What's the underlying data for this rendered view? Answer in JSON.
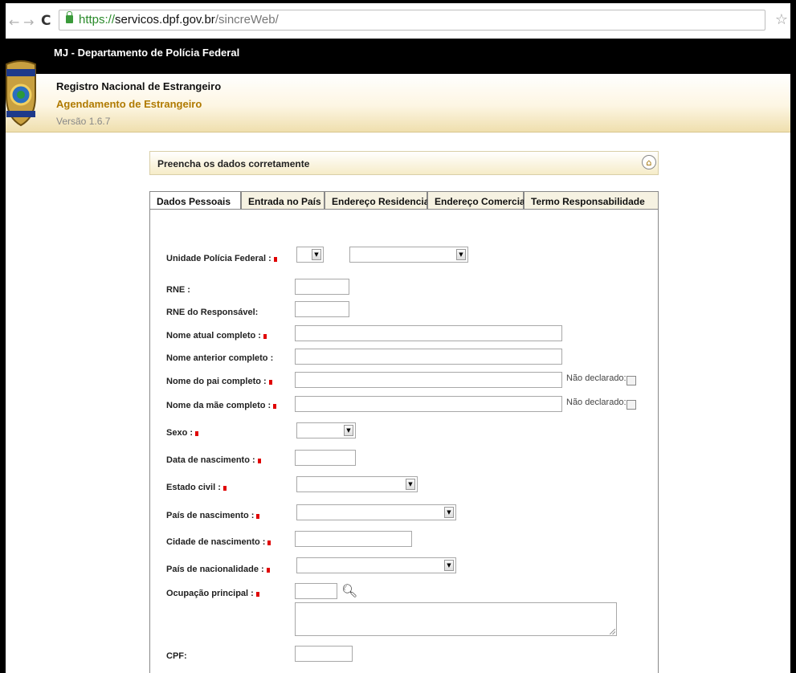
{
  "browser": {
    "url_scheme": "https://",
    "url_host": "servicos.dpf.gov.br",
    "url_path": "/sincreWeb/"
  },
  "header": {
    "org": "MJ - Departamento de Polícia Federal",
    "system": "Registro Nacional de Estrangeiro",
    "module": "Agendamento de Estrangeiro",
    "version": "Versão 1.6.7"
  },
  "panel": {
    "title": "Preencha os dados corretamente"
  },
  "tabs": [
    {
      "label": "Dados Pessoais",
      "active": true
    },
    {
      "label": "Entrada no País",
      "active": false
    },
    {
      "label": "Endereço Residencial",
      "active": false
    },
    {
      "label": "Endereço Comercial",
      "active": false
    },
    {
      "label": "Termo Responsabilidade",
      "active": false
    }
  ],
  "form": {
    "unidade": "Unidade Polícia Federal :",
    "rne": "RNE :",
    "rne_resp": "RNE do Responsável:",
    "nome_atual": "Nome atual completo :",
    "nome_anterior": "Nome anterior completo :",
    "nome_pai": "Nome do pai completo :",
    "nome_mae": "Nome da mãe completo :",
    "sexo": "Sexo :",
    "data_nasc": "Data de nascimento :",
    "estado_civil": "Estado civil :",
    "pais_nasc": "País de nascimento :",
    "cidade_nasc": "Cidade de nascimento :",
    "pais_nac": "País de nacionalidade :",
    "ocupacao": "Ocupação principal :",
    "cpf": "CPF:",
    "nao_declarado": "Não declarado:"
  },
  "colors": {
    "required_marker": "#e00000",
    "header_bar": "#000000",
    "module_text": "#b07a00"
  }
}
